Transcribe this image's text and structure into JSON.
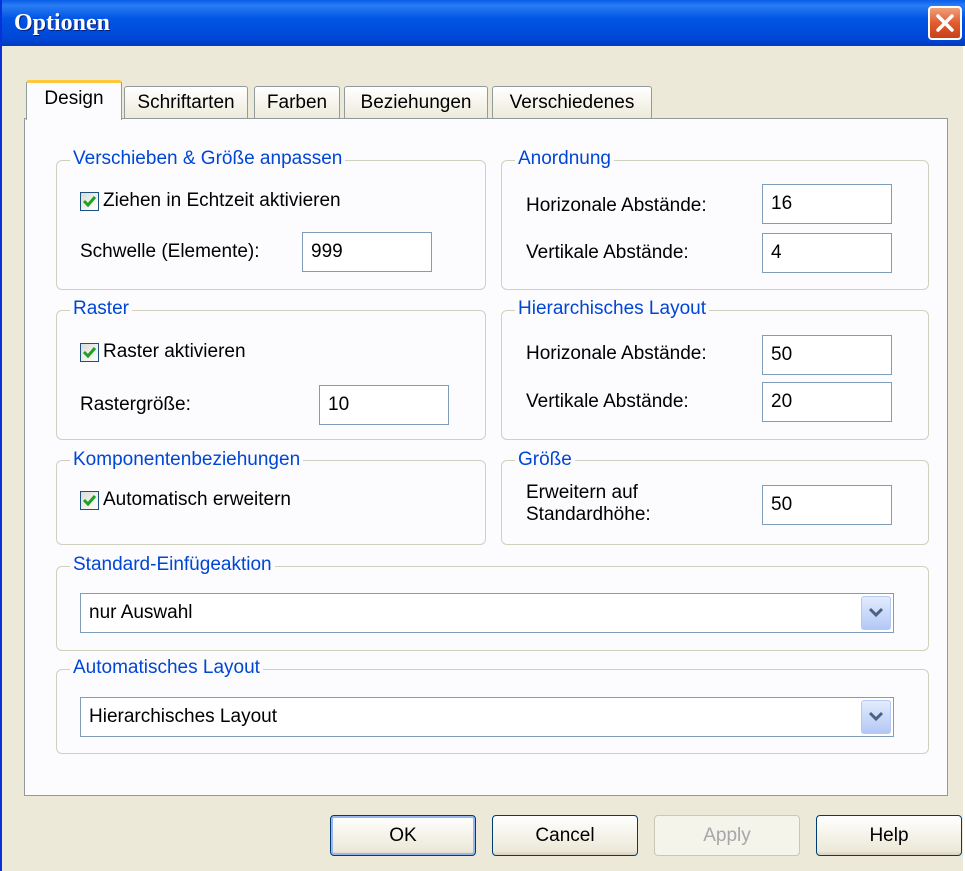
{
  "window": {
    "title": "Optionen"
  },
  "tabs": [
    "Design",
    "Schriftarten",
    "Farben",
    "Beziehungen",
    "Verschiedenes"
  ],
  "move_resize": {
    "legend": "Verschieben & Größe anpassen",
    "realtime_drag_label": "Ziehen in Echtzeit aktivieren",
    "realtime_drag_checked": true,
    "threshold_label": "Schwelle (Elemente):",
    "threshold_value": "999"
  },
  "arrangement": {
    "legend": "Anordnung",
    "horizontal_label": "Horizonale Abstände:",
    "horizontal_value": "16",
    "vertical_label": "Vertikale Abstände:",
    "vertical_value": "4"
  },
  "grid": {
    "legend": "Raster",
    "enable_label": "Raster aktivieren",
    "enable_checked": true,
    "size_label": "Rastergröße:",
    "size_value": "10"
  },
  "hierarchical_layout": {
    "legend": "Hierarchisches Layout",
    "horizontal_label": "Horizonale Abstände:",
    "horizontal_value": "50",
    "vertical_label": "Vertikale Abstände:",
    "vertical_value": "20"
  },
  "component_relations": {
    "legend": "Komponentenbeziehungen",
    "auto_expand_label": "Automatisch erweitern",
    "auto_expand_checked": true
  },
  "size": {
    "legend": "Größe",
    "expand_label": "Erweitern auf Standardhöhe:",
    "expand_value": "50"
  },
  "default_insert": {
    "legend": "Standard-Einfügeaktion",
    "selected": "nur Auswahl"
  },
  "auto_layout": {
    "legend": "Automatisches Layout",
    "selected": "Hierarchisches Layout"
  },
  "buttons": {
    "ok": "OK",
    "cancel": "Cancel",
    "apply": "Apply",
    "help": "Help"
  },
  "colors": {
    "titlebar": "#0055e5",
    "legend_text": "#0046d5",
    "dialog_bg": "#ece9d8",
    "close_button": "#e05c2e"
  }
}
